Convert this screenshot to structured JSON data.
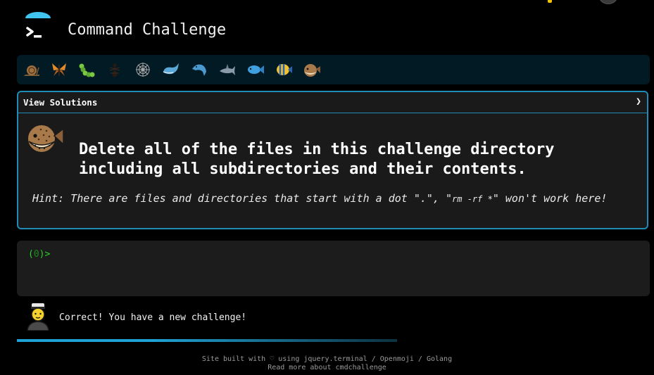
{
  "header": {
    "title": "Command Challenge",
    "logo_icon": "terminal-prompt-icon",
    "logo_accent": "#3fc5f0"
  },
  "badges": [
    {
      "name": "snail-icon"
    },
    {
      "name": "butterfly-icon"
    },
    {
      "name": "caterpillar-icon"
    },
    {
      "name": "ant-icon"
    },
    {
      "name": "spider-web-icon"
    },
    {
      "name": "whale-icon"
    },
    {
      "name": "dolphin-icon"
    },
    {
      "name": "shark-icon"
    },
    {
      "name": "fish-icon"
    },
    {
      "name": "tropical-fish-icon"
    },
    {
      "name": "blowfish-icon"
    }
  ],
  "challenge": {
    "view_solutions_label": "View Solutions",
    "chevron": "❯",
    "heading": "Delete all of the files in this challenge directory including all subdirectories and their contents.",
    "hint_prefix": "Hint: There are files and directories that start with a dot \".\", \"",
    "hint_code": "rm -rf *",
    "hint_suffix": "\" won't work here!"
  },
  "terminal": {
    "prompt_open": "(",
    "prompt_count": "0",
    "prompt_close": ")>"
  },
  "status": {
    "message": "Correct! You have a new challenge!"
  },
  "footer": {
    "line1": "Site built with ♡ using jquery.terminal / Openmoji / Golang",
    "line2": "Read more about cmdchallenge"
  },
  "colors": {
    "accent": "#1f8bb6",
    "badge_bar": "#021a24",
    "prompt": "#2ccf2c"
  }
}
